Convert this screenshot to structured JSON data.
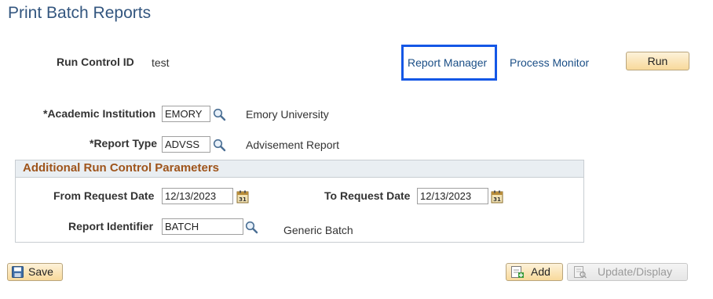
{
  "page": {
    "title": "Print Batch Reports"
  },
  "run_control": {
    "label": "Run Control ID",
    "value": "test"
  },
  "links": {
    "report_manager": "Report Manager",
    "process_monitor": "Process Monitor"
  },
  "buttons": {
    "run": "Run",
    "save": "Save",
    "add": "Add",
    "update_display": "Update/Display"
  },
  "academic_institution": {
    "label": "*Academic Institution",
    "value": "EMORY",
    "description": "Emory University"
  },
  "report_type": {
    "label": "*Report Type",
    "value": "ADVSS",
    "description": "Advisement Report"
  },
  "params": {
    "title": "Additional Run Control Parameters",
    "from_date": {
      "label": "From Request Date",
      "value": "12/13/2023"
    },
    "to_date": {
      "label": "To Request Date",
      "value": "12/13/2023"
    },
    "report_id": {
      "label": "Report Identifier",
      "value": "BATCH",
      "description": "Generic Batch"
    }
  },
  "colors": {
    "title": "#33567f",
    "link": "#1a4e86",
    "highlight": "#1457e6",
    "section_title": "#9e541b",
    "button": "#f8d99b"
  },
  "icons": {
    "lookup": "magnifier-icon",
    "calendar": "calendar-icon",
    "save": "save-icon",
    "add": "add-icon",
    "update": "update-display-icon"
  }
}
